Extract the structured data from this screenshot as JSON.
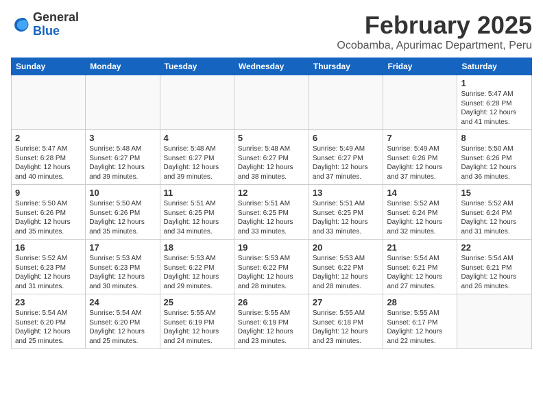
{
  "header": {
    "logo_general": "General",
    "logo_blue": "Blue",
    "month_title": "February 2025",
    "location": "Ocobamba, Apurimac Department, Peru"
  },
  "days_of_week": [
    "Sunday",
    "Monday",
    "Tuesday",
    "Wednesday",
    "Thursday",
    "Friday",
    "Saturday"
  ],
  "weeks": [
    {
      "days": [
        {
          "number": "",
          "info": ""
        },
        {
          "number": "",
          "info": ""
        },
        {
          "number": "",
          "info": ""
        },
        {
          "number": "",
          "info": ""
        },
        {
          "number": "",
          "info": ""
        },
        {
          "number": "",
          "info": ""
        },
        {
          "number": "1",
          "info": "Sunrise: 5:47 AM\nSunset: 6:28 PM\nDaylight: 12 hours and 41 minutes."
        }
      ]
    },
    {
      "days": [
        {
          "number": "2",
          "info": "Sunrise: 5:47 AM\nSunset: 6:28 PM\nDaylight: 12 hours and 40 minutes."
        },
        {
          "number": "3",
          "info": "Sunrise: 5:48 AM\nSunset: 6:27 PM\nDaylight: 12 hours and 39 minutes."
        },
        {
          "number": "4",
          "info": "Sunrise: 5:48 AM\nSunset: 6:27 PM\nDaylight: 12 hours and 39 minutes."
        },
        {
          "number": "5",
          "info": "Sunrise: 5:48 AM\nSunset: 6:27 PM\nDaylight: 12 hours and 38 minutes."
        },
        {
          "number": "6",
          "info": "Sunrise: 5:49 AM\nSunset: 6:27 PM\nDaylight: 12 hours and 37 minutes."
        },
        {
          "number": "7",
          "info": "Sunrise: 5:49 AM\nSunset: 6:26 PM\nDaylight: 12 hours and 37 minutes."
        },
        {
          "number": "8",
          "info": "Sunrise: 5:50 AM\nSunset: 6:26 PM\nDaylight: 12 hours and 36 minutes."
        }
      ]
    },
    {
      "days": [
        {
          "number": "9",
          "info": "Sunrise: 5:50 AM\nSunset: 6:26 PM\nDaylight: 12 hours and 35 minutes."
        },
        {
          "number": "10",
          "info": "Sunrise: 5:50 AM\nSunset: 6:26 PM\nDaylight: 12 hours and 35 minutes."
        },
        {
          "number": "11",
          "info": "Sunrise: 5:51 AM\nSunset: 6:25 PM\nDaylight: 12 hours and 34 minutes."
        },
        {
          "number": "12",
          "info": "Sunrise: 5:51 AM\nSunset: 6:25 PM\nDaylight: 12 hours and 33 minutes."
        },
        {
          "number": "13",
          "info": "Sunrise: 5:51 AM\nSunset: 6:25 PM\nDaylight: 12 hours and 33 minutes."
        },
        {
          "number": "14",
          "info": "Sunrise: 5:52 AM\nSunset: 6:24 PM\nDaylight: 12 hours and 32 minutes."
        },
        {
          "number": "15",
          "info": "Sunrise: 5:52 AM\nSunset: 6:24 PM\nDaylight: 12 hours and 31 minutes."
        }
      ]
    },
    {
      "days": [
        {
          "number": "16",
          "info": "Sunrise: 5:52 AM\nSunset: 6:23 PM\nDaylight: 12 hours and 31 minutes."
        },
        {
          "number": "17",
          "info": "Sunrise: 5:53 AM\nSunset: 6:23 PM\nDaylight: 12 hours and 30 minutes."
        },
        {
          "number": "18",
          "info": "Sunrise: 5:53 AM\nSunset: 6:22 PM\nDaylight: 12 hours and 29 minutes."
        },
        {
          "number": "19",
          "info": "Sunrise: 5:53 AM\nSunset: 6:22 PM\nDaylight: 12 hours and 28 minutes."
        },
        {
          "number": "20",
          "info": "Sunrise: 5:53 AM\nSunset: 6:22 PM\nDaylight: 12 hours and 28 minutes."
        },
        {
          "number": "21",
          "info": "Sunrise: 5:54 AM\nSunset: 6:21 PM\nDaylight: 12 hours and 27 minutes."
        },
        {
          "number": "22",
          "info": "Sunrise: 5:54 AM\nSunset: 6:21 PM\nDaylight: 12 hours and 26 minutes."
        }
      ]
    },
    {
      "days": [
        {
          "number": "23",
          "info": "Sunrise: 5:54 AM\nSunset: 6:20 PM\nDaylight: 12 hours and 25 minutes."
        },
        {
          "number": "24",
          "info": "Sunrise: 5:54 AM\nSunset: 6:20 PM\nDaylight: 12 hours and 25 minutes."
        },
        {
          "number": "25",
          "info": "Sunrise: 5:55 AM\nSunset: 6:19 PM\nDaylight: 12 hours and 24 minutes."
        },
        {
          "number": "26",
          "info": "Sunrise: 5:55 AM\nSunset: 6:19 PM\nDaylight: 12 hours and 23 minutes."
        },
        {
          "number": "27",
          "info": "Sunrise: 5:55 AM\nSunset: 6:18 PM\nDaylight: 12 hours and 23 minutes."
        },
        {
          "number": "28",
          "info": "Sunrise: 5:55 AM\nSunset: 6:17 PM\nDaylight: 12 hours and 22 minutes."
        },
        {
          "number": "",
          "info": ""
        }
      ]
    }
  ]
}
